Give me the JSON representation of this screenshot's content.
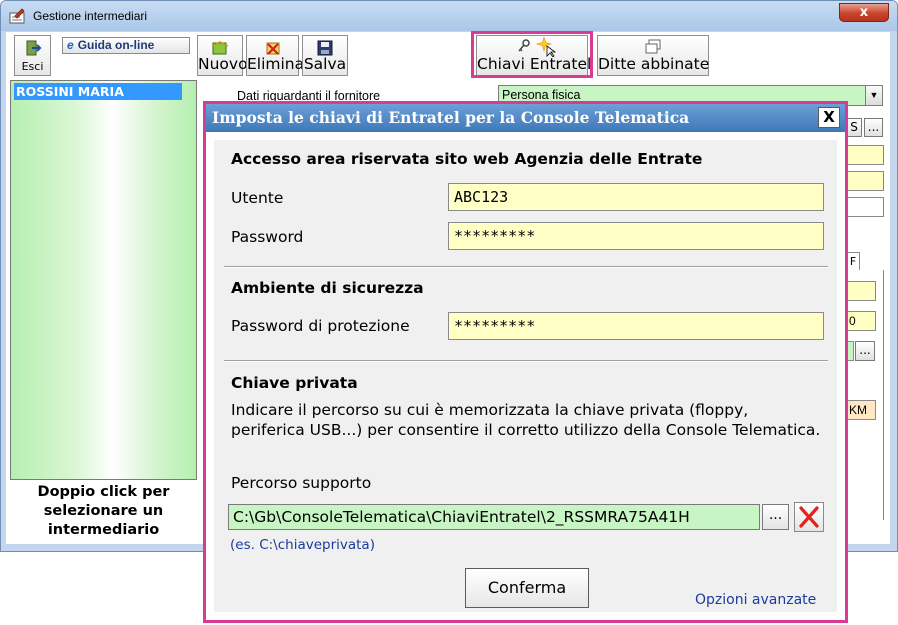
{
  "window": {
    "title": "Gestione intermediari",
    "close_glyph": "x"
  },
  "toolbar": {
    "esci": "Esci",
    "guida": "Guida on-line",
    "nuovo": "Nuovo",
    "elimina": "Elimina",
    "salva": "Salva",
    "chiavi": "Chiavi Entratel",
    "ditte": "Ditte abbinate"
  },
  "list": {
    "selected_item": "ROSSINI MARIA",
    "hint": "Doppio click per selezionare un intermediario"
  },
  "form_bg": {
    "fornitore_label": "Dati riguardanti il fornitore",
    "fornitore_value": "Persona fisica",
    "s_button": "S",
    "ellipsis": "...",
    "partial_f": "F",
    "partial_zero": "0",
    "partial_km": "KM"
  },
  "dialog": {
    "title": "Imposta le chiavi di Entratel per la Console Telematica",
    "close_glyph": "X",
    "section_access": "Accesso area riservata sito web Agenzia delle Entrate",
    "utente_label": "Utente",
    "utente_value": "ABC123",
    "password_label": "Password",
    "password_value": "*********",
    "section_security": "Ambiente di sicurezza",
    "protection_label": "Password di protezione",
    "protection_value": "*********",
    "section_key": "Chiave privata",
    "key_description": "Indicare il percorso su cui è memorizzata la chiave privata (floppy, periferica USB...) per consentire il corretto utilizzo della Console Telematica.",
    "path_label": "Percorso supporto",
    "path_value": "C:\\Gb\\ConsoleTelematica\\ChiaviEntratel\\2_RSSMRA75A41H",
    "browse_label": "...",
    "path_example": "(es. C:\\chiaveprivata)",
    "confirm_label": "Conferma",
    "advanced_link": "Opzioni avanzate"
  },
  "colors": {
    "highlight": "#d83b96",
    "dialog_title_bg": "#3e78ba",
    "yellow_input": "#ffffc6",
    "green_input": "#c7f5c3",
    "link_blue": "#1b3b9e"
  }
}
